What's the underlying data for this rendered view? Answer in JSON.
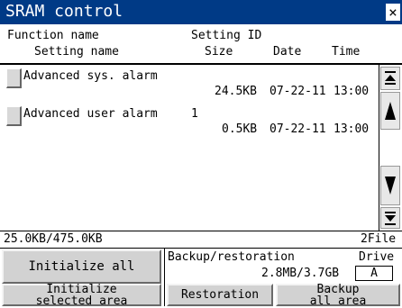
{
  "window": {
    "title": "SRAM control",
    "close_glyph": "×"
  },
  "header": {
    "function_name": "Function name",
    "setting_id": "Setting ID",
    "setting_name": "Setting name",
    "size": "Size",
    "date": "Date",
    "time": "Time"
  },
  "rows": [
    {
      "function_name": "Advanced sys. alarm",
      "setting_id": "",
      "size": "24.5KB",
      "date": "07-22-11",
      "time": "13:00"
    },
    {
      "function_name": "Advanced user alarm",
      "setting_id": "1",
      "size": "0.5KB",
      "date": "07-22-11",
      "time": "13:00"
    }
  ],
  "status": {
    "usage": "25.0KB/475.0KB",
    "file_count": "2File"
  },
  "backup": {
    "label": "Backup/restoration",
    "drive_label": "Drive",
    "capacity": "2.8MB/3.7GB",
    "drive_value": "A"
  },
  "buttons": {
    "initialize_all": "Initialize all",
    "initialize_selected": "Initialize\nselected area",
    "restoration": "Restoration",
    "backup_all": "Backup\nall area"
  },
  "scroll_icons": [
    "scroll-top-icon",
    "scroll-up-icon",
    "scroll-down-icon",
    "scroll-bottom-icon"
  ]
}
